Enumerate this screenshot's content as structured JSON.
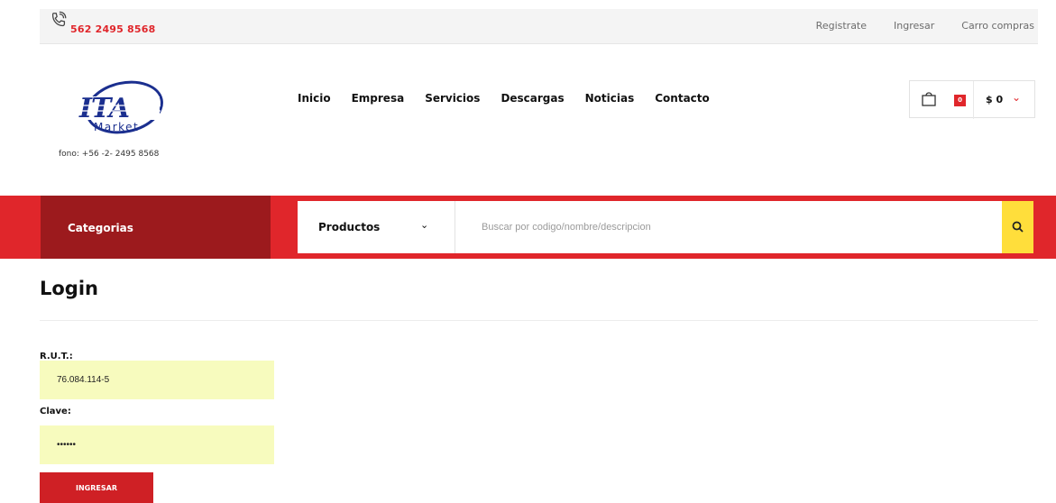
{
  "topbar": {
    "phone": "562 2495 8568",
    "links": [
      "Registrate",
      "Ingresar",
      "Carro compras"
    ]
  },
  "logo": {
    "text": "ITA",
    "subtext": "Market",
    "fono": "fono:  +56 -2- 2495 8568"
  },
  "nav": {
    "items": [
      "Inicio",
      "Empresa",
      "Servicios",
      "Descargas",
      "Noticias",
      "Contacto"
    ]
  },
  "cart": {
    "count": "0",
    "total": "$ 0"
  },
  "search": {
    "categories_label": "Categorias",
    "selected_scope": "Productos",
    "placeholder": "Buscar por codigo/nombre/descripcion"
  },
  "login": {
    "title": "Login",
    "rut_label": "R.U.T.:",
    "rut_value": "76.084.114-5",
    "clave_label": "Clave:",
    "clave_value": "••••••",
    "submit_label": "INGRESAR"
  },
  "colors": {
    "brand_red": "#e0262b",
    "dark_red": "#9c1a1d",
    "search_yellow": "#ffde3b",
    "field_yellow": "#f7fbbe",
    "logo_blue": "#1b2f8f"
  }
}
